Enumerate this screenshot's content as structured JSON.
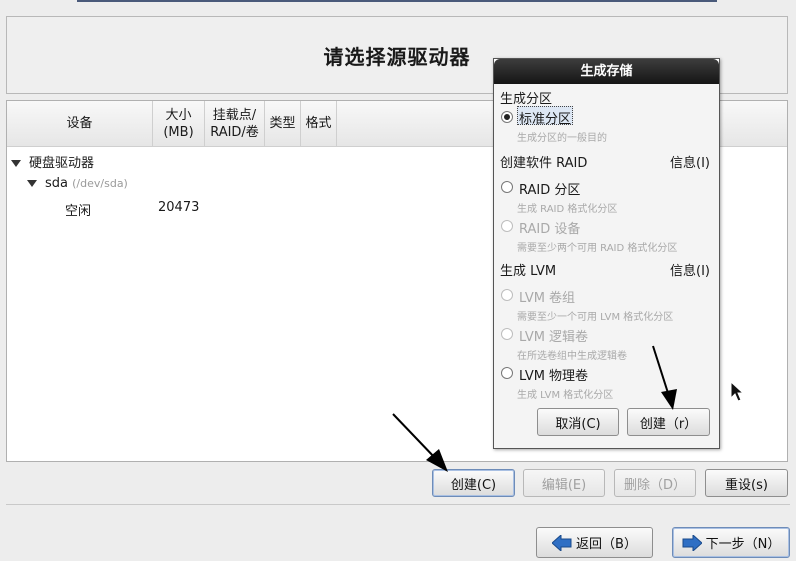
{
  "page": {
    "title": "请选择源驱动器"
  },
  "table": {
    "headers": {
      "device": "设备",
      "size": "大小\n(MB)",
      "mount": "挂载点/\nRAID/卷",
      "type": "类型",
      "format": "格式"
    },
    "rows": [
      {
        "label": "硬盘驱动器"
      },
      {
        "label": "sda",
        "sublabel": "(/dev/sda)"
      },
      {
        "label": "空闲",
        "size": "20473"
      }
    ]
  },
  "buttons": {
    "create": "创建(C)",
    "edit": "编辑(E)",
    "delete": "删除（D）",
    "reset": "重设(s)",
    "back": "返回（B）",
    "next": "下一步（N）"
  },
  "dialog": {
    "title": "生成存储",
    "section_partition": "生成分区",
    "opt_standard": "标准分区",
    "opt_standard_desc": "生成分区的一般目的",
    "section_raid": "创建软件 RAID",
    "info_raid": "信息(I)",
    "opt_raid_partition": "RAID 分区",
    "opt_raid_partition_desc": "生成 RAID 格式化分区",
    "opt_raid_device": "RAID 设备",
    "opt_raid_device_desc": "需要至少两个可用 RAID 格式化分区",
    "section_lvm": "生成 LVM",
    "info_lvm": "信息(I)",
    "opt_lvm_vg": "LVM 卷组",
    "opt_lvm_vg_desc": "需要至少一个可用 LVM 格式化分区",
    "opt_lvm_lv": "LVM 逻辑卷",
    "opt_lvm_lv_desc": "在所选卷组中生成逻辑卷",
    "opt_lvm_pv": "LVM 物理卷",
    "opt_lvm_pv_desc": "生成 LVM 格式化分区",
    "cancel": "取消(C)",
    "create": "创建（r）"
  },
  "colors": {
    "dialog_titlebar": "#151515",
    "next_arrow": "#2f6fc4",
    "back_arrow": "#2f6fc4"
  }
}
